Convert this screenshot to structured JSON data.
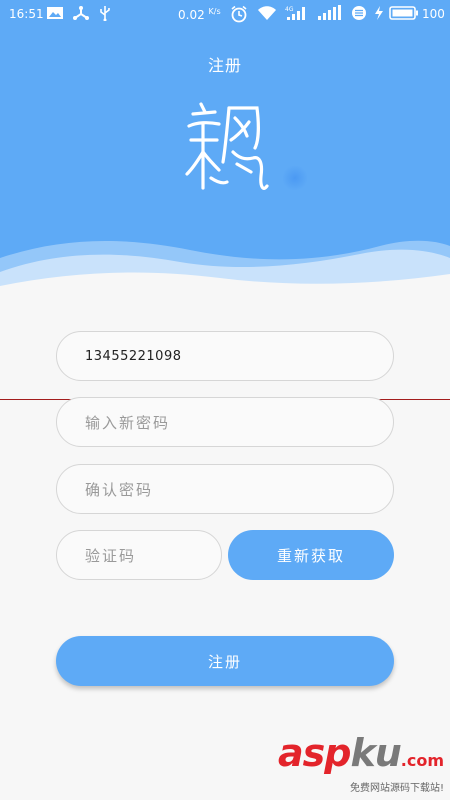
{
  "status_bar": {
    "time": "16:51",
    "net_speed": "0.02",
    "net_speed_unit": "K/s",
    "network_type": "4G",
    "battery": "100"
  },
  "header": {
    "title": "注册",
    "logo_glyph": "飘"
  },
  "form": {
    "phone_value": "13455221098",
    "new_password_placeholder": "输入新密码",
    "confirm_password_placeholder": "确认密码",
    "code_placeholder": "验证码",
    "resend_label": "重新获取",
    "submit_label": "注册"
  },
  "watermark": {
    "brand_asp": "asp",
    "brand_ku": "ku",
    "brand_com": ".com",
    "tagline": "免费网站源码下载站!"
  },
  "colors": {
    "primary": "#5eaaf6",
    "background": "#f7f7f7",
    "input_border": "#d6d6d6",
    "placeholder": "#9a9a9a",
    "watermark_red": "#e3242b"
  }
}
